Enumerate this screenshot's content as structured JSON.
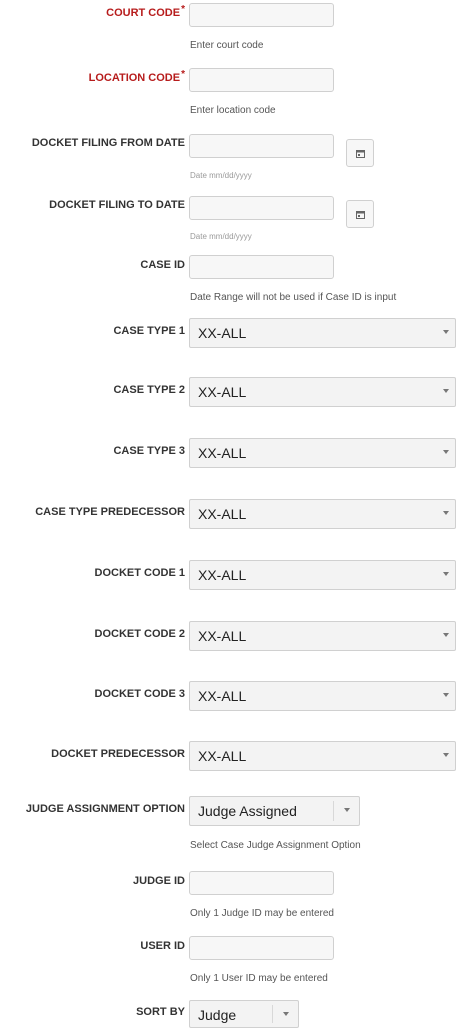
{
  "fields": {
    "court_code": {
      "label": "COURT CODE",
      "required": "*",
      "value": "",
      "help": "Enter court code"
    },
    "location_code": {
      "label": "LOCATION CODE",
      "required": "*",
      "value": "",
      "help": "Enter location code"
    },
    "filing_from": {
      "label": "DOCKET FILING FROM DATE",
      "value": "",
      "help": "Date mm/dd/yyyy"
    },
    "filing_to": {
      "label": "DOCKET FILING TO DATE",
      "value": "",
      "help": "Date mm/dd/yyyy"
    },
    "case_id": {
      "label": "CASE ID",
      "value": "",
      "help": "Date Range will not be used if Case ID is input"
    },
    "case_type_1": {
      "label": "CASE TYPE 1",
      "value": "XX-ALL"
    },
    "case_type_2": {
      "label": "CASE TYPE 2",
      "value": "XX-ALL"
    },
    "case_type_3": {
      "label": "CASE TYPE 3",
      "value": "XX-ALL"
    },
    "case_type_pred": {
      "label": "CASE TYPE PREDECESSOR",
      "value": "XX-ALL"
    },
    "docket_code_1": {
      "label": "DOCKET CODE 1",
      "value": "XX-ALL"
    },
    "docket_code_2": {
      "label": "DOCKET CODE 2",
      "value": "XX-ALL"
    },
    "docket_code_3": {
      "label": "DOCKET CODE 3",
      "value": "XX-ALL"
    },
    "docket_pred": {
      "label": "DOCKET PREDECESSOR",
      "value": "XX-ALL"
    },
    "judge_assign": {
      "label": "JUDGE ASSIGNMENT OPTION",
      "value": "Judge Assigned",
      "help": "Select Case Judge Assignment Option"
    },
    "judge_id": {
      "label": "JUDGE ID",
      "value": "",
      "help": "Only 1 Judge ID may be entered"
    },
    "user_id": {
      "label": "USER ID",
      "value": "",
      "help": "Only 1 User ID may be entered"
    },
    "sort_by": {
      "label": "SORT BY",
      "value": "Judge"
    }
  },
  "icons": {
    "calendar": "calendar-icon",
    "dropdown": "chevron-down-icon"
  },
  "colors": {
    "required": "#b71c1c",
    "help_small": "#9a9a9a"
  }
}
